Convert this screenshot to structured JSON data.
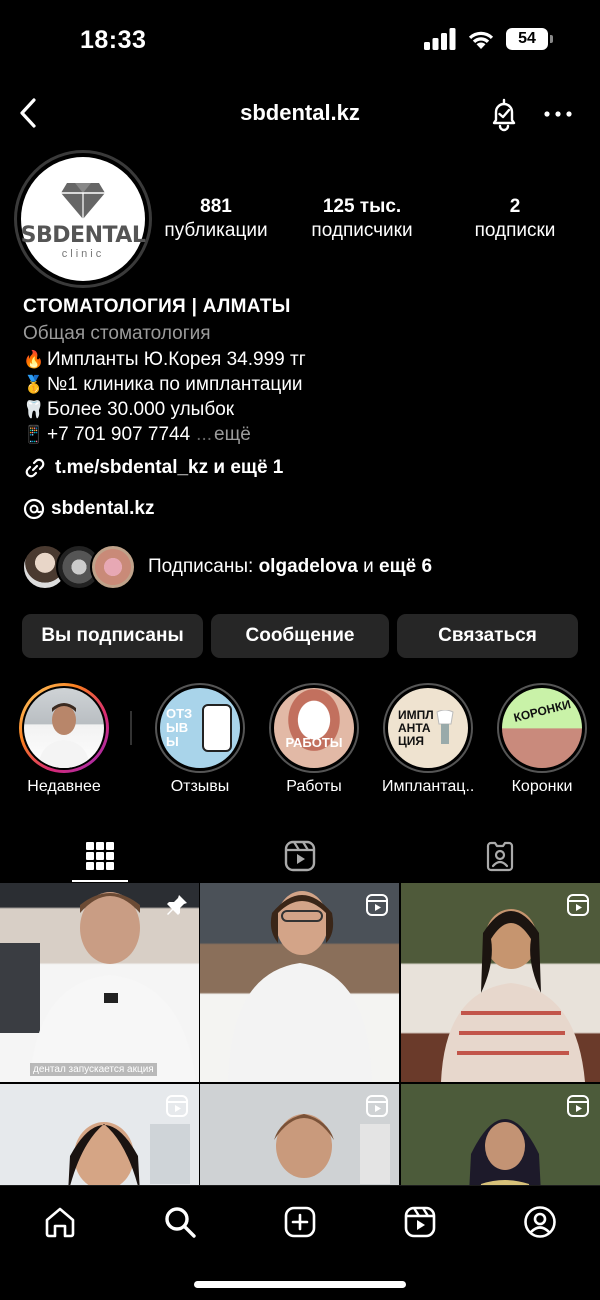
{
  "status_bar": {
    "time": "18:33",
    "battery": "54"
  },
  "header": {
    "username": "sbdental.kz"
  },
  "profile": {
    "avatar_brand": "SBDENTAL",
    "avatar_sub": "clinic",
    "stats": [
      {
        "value": "881",
        "label": "публикации"
      },
      {
        "value": "125 тыс.",
        "label": "подписчики"
      },
      {
        "value": "2",
        "label": "подписки"
      }
    ],
    "name": "СТОМАТОЛОГИЯ | АЛМАТЫ",
    "category": "Общая стоматология",
    "bio_lines": [
      {
        "emoji": "🔥",
        "text": "Импланты Ю.Корея 34.999 тг"
      },
      {
        "emoji": "🥇",
        "text": "№1 клиника по имплантации"
      },
      {
        "emoji": "🦷",
        "text": "Более 30.000 улыбок"
      },
      {
        "emoji": "📱",
        "text": " +7 701 907 7744"
      }
    ],
    "more_dots": "...",
    "more_label": "ещё",
    "link_text": "t.me/sbdental_kz и ещё 1",
    "threads_text": "sbdental.kz",
    "followers": {
      "prefix": "Подписаны:",
      "name": "olgadelova",
      "joiner": "и",
      "rest": "ещё 6"
    }
  },
  "buttons": {
    "following": "Вы подписаны",
    "message": "Сообщение",
    "contact": "Связаться"
  },
  "highlights": [
    {
      "label": "Недавнее",
      "cover": ""
    },
    {
      "label": "Отзывы",
      "cover": "ОТЗЫВЫ"
    },
    {
      "label": "Работы",
      "cover": "РАБОТЫ"
    },
    {
      "label": "Имплантац...",
      "cover": "ИМПЛАНТАЦИЯ"
    },
    {
      "label": "Коронки",
      "cover": "КОРОНКИ"
    }
  ],
  "grid": [
    {
      "type": "pinned",
      "caption": "дентал запускается акция"
    },
    {
      "type": "reel",
      "caption": ""
    },
    {
      "type": "reel",
      "caption": ""
    },
    {
      "type": "reel",
      "caption": ""
    },
    {
      "type": "reel",
      "caption": ""
    },
    {
      "type": "reel",
      "caption": ""
    }
  ],
  "icons": {
    "back": "chevron-left-icon",
    "bell": "notification-bell-icon",
    "more": "more-horizontal-icon",
    "link": "link-icon",
    "threads": "threads-icon",
    "grid_tab": "grid-icon",
    "reels_tab": "reels-icon",
    "tagged_tab": "tagged-icon",
    "home": "home-icon",
    "search": "search-icon",
    "create": "create-icon",
    "reels": "reels-icon",
    "profile": "profile-icon"
  },
  "colors": {
    "background": "#000000",
    "button_bg": "#262626",
    "muted_text": "#9a9a9a"
  }
}
